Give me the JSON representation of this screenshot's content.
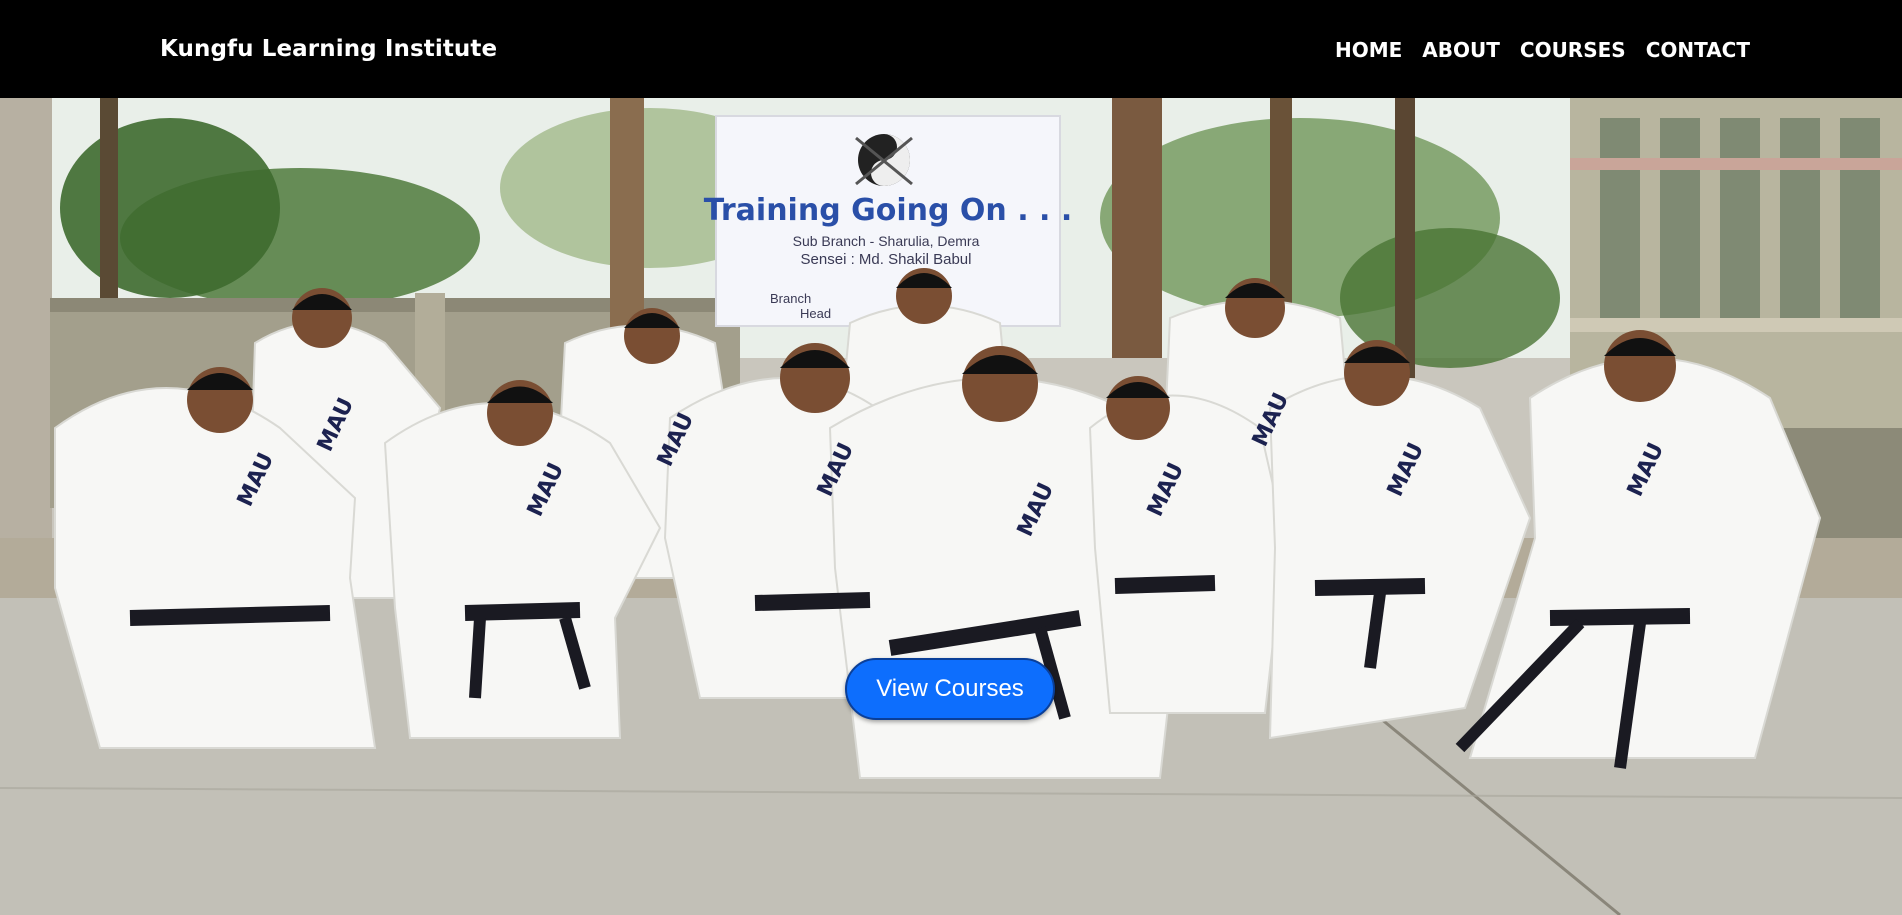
{
  "navbar": {
    "brand": "Kungfu Learning Institute",
    "links": [
      "HOME",
      "ABOUT",
      "COURSES",
      "CONTACT"
    ]
  },
  "hero": {
    "banner": {
      "title": "Training Going On . . .",
      "line1": "Sub Branch - Sharulia, Demra",
      "line2": "Sensei : Md. Shakil Babul",
      "line3": "Branch",
      "line4": "Head",
      "emblem": "yin-yang-emblem"
    },
    "uniform_logo": "MAU",
    "cta_label": "View Courses"
  },
  "colors": {
    "navbar_bg": "#000000",
    "cta_bg": "#0d6efd",
    "banner_text": "#2a4fa8"
  }
}
